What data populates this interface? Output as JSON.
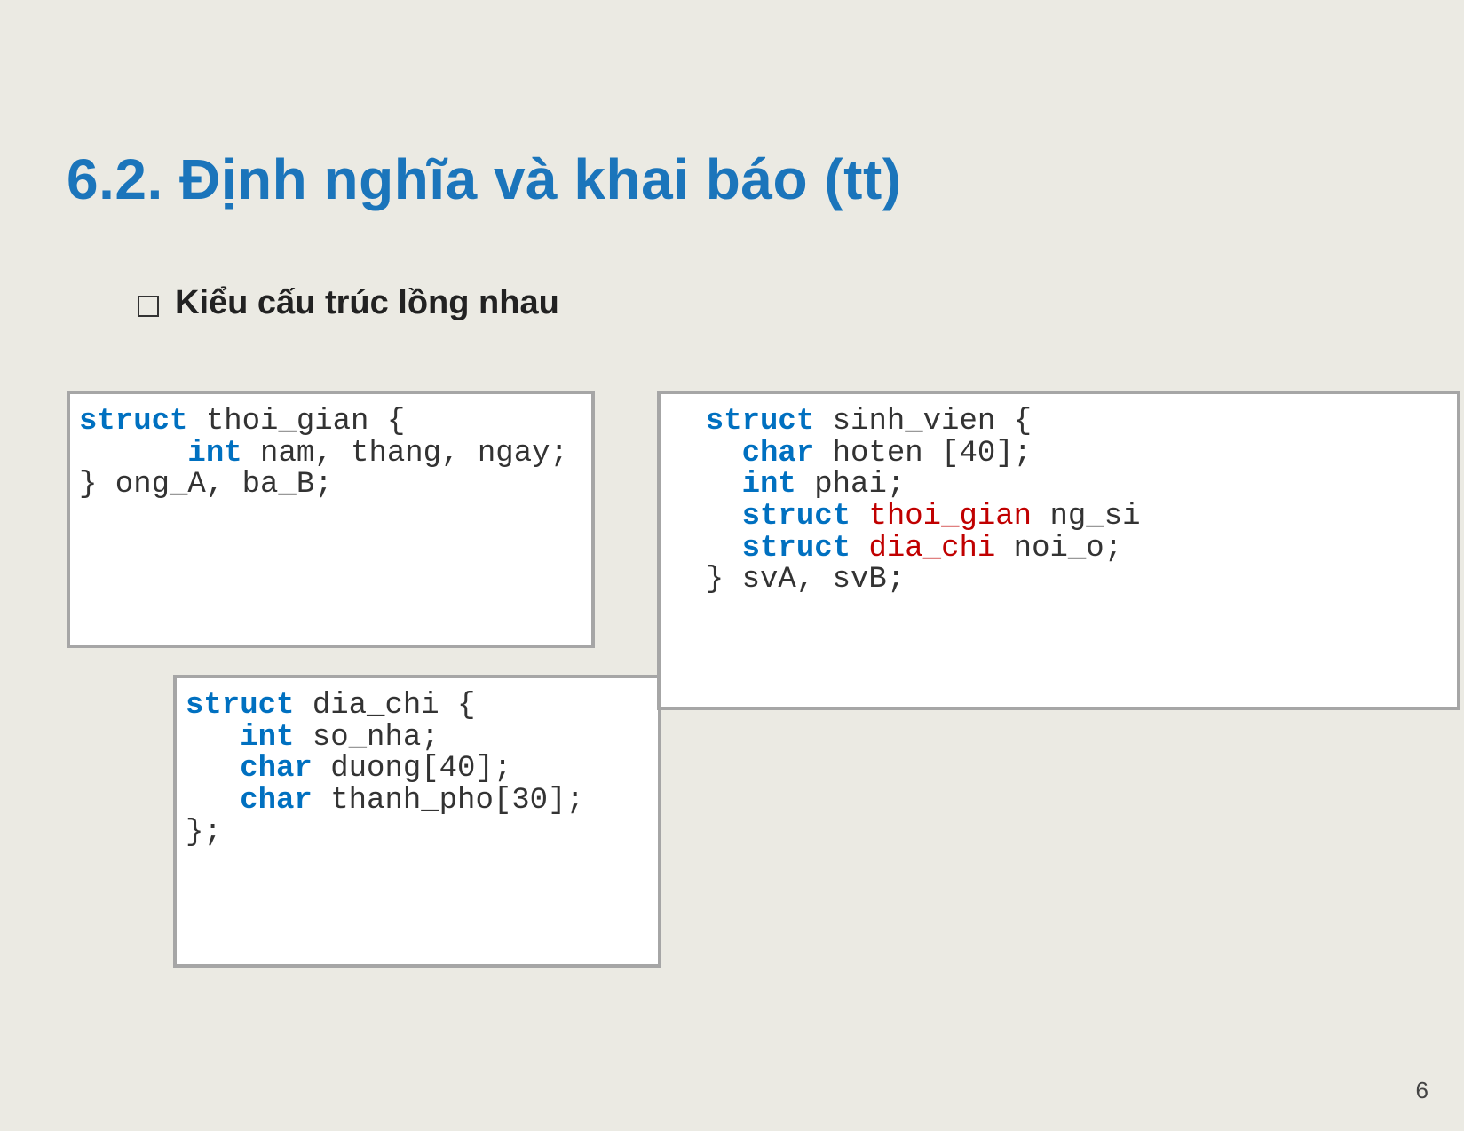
{
  "title": "6.2. Định nghĩa và khai báo (tt)",
  "subtitle": "Kiểu cấu trúc lồng nhau",
  "page_number": "6",
  "code_blocks": {
    "thoi_gian": {
      "l1a": "struct",
      "l1b": " thoi_gian {",
      "l2a": "      int",
      "l2b": " nam, thang, ngay;",
      "l3": "} ong_A, ba_B;"
    },
    "dia_chi": {
      "l1a": "struct",
      "l1b": " dia_chi {",
      "l2a": "   int",
      "l2b": " so_nha;",
      "l3a": "   char",
      "l3b": " duong[40];",
      "l4a": "   char",
      "l4b": " thanh_pho[30];",
      "l5": "};"
    },
    "sinh_vien": {
      "l1a": "  struct",
      "l1b": " sinh_vien {",
      "l2a": "    char",
      "l2b": " hoten [40];",
      "l3a": "    int",
      "l3b": " phai;",
      "l4a": "    struct",
      "l4b": " thoi_gian",
      "l4c": " ng_si",
      "l5a": "    struct",
      "l5b": " dia_chi",
      "l5c": " noi_o;",
      "l6": "  } svA, svB;"
    }
  }
}
